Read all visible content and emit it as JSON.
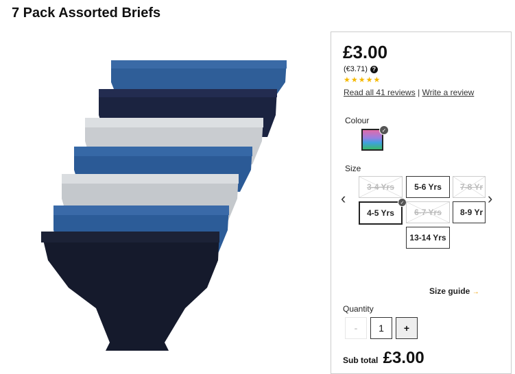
{
  "product": {
    "title": "7 Pack Assorted Briefs"
  },
  "price": {
    "main": "£3.00",
    "euro": "(€3.71)",
    "help_icon": "?"
  },
  "rating": {
    "stars": 5,
    "star_glyph": "★",
    "reviews_link": "Read all 41 reviews",
    "separator": "|",
    "write_link": "Write a review"
  },
  "colour": {
    "label": "Colour"
  },
  "size": {
    "label": "Size",
    "prev_arrow": "‹",
    "next_arrow": "›",
    "options": [
      {
        "label": "3-4 Yrs",
        "state": "unavailable"
      },
      {
        "label": "5-6 Yrs",
        "state": "available"
      },
      {
        "label": "7-8 Yr",
        "state": "unavailable"
      },
      {
        "label": "4-5 Yrs",
        "state": "selected"
      },
      {
        "label": "6-7 Yrs",
        "state": "unavailable"
      },
      {
        "label": "8-9 Yr",
        "state": "available"
      },
      {
        "label": "13-14 Yrs",
        "state": "available"
      }
    ],
    "guide": "Size guide",
    "guide_arrow": "→"
  },
  "quantity": {
    "label": "Quantity",
    "minus": "-",
    "value": "1",
    "plus": "+"
  },
  "subtotal": {
    "label": "Sub total",
    "value": "£3.00"
  },
  "icons": {
    "check": "✓"
  }
}
